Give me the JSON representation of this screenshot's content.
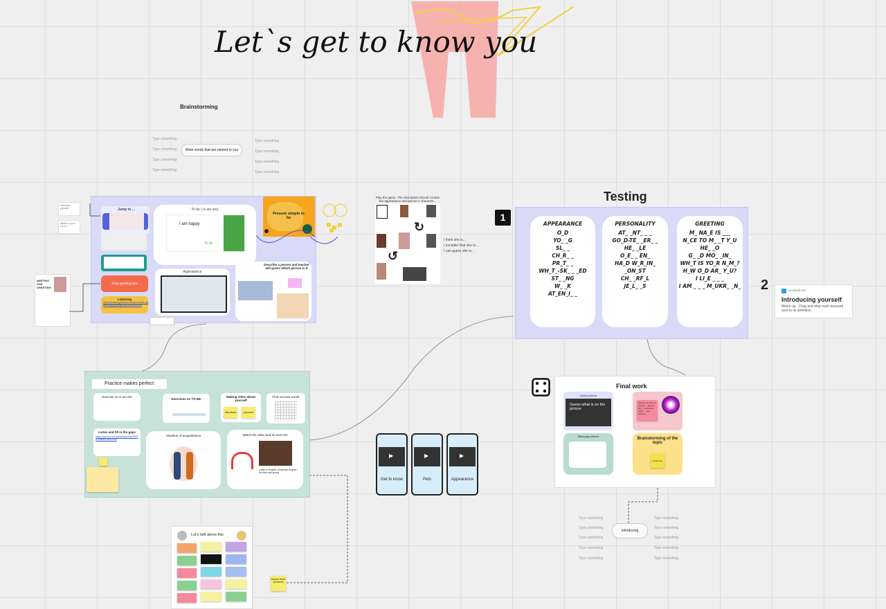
{
  "board": {
    "title": "Let`s get to know you",
    "brainstorm": {
      "label": "Brainstorming",
      "center": "Write words that are related to you",
      "nodes": [
        "Type something",
        "Type something",
        "Type something",
        "Type something",
        "Type something",
        "Type something",
        "Type something",
        "Type something"
      ]
    },
    "left_frame": {
      "jump_label": "Jump to ...",
      "to_be_title": "To be ( is am are)",
      "i_am_happy": "I am happy",
      "to_be_small": "To be",
      "present_simple": "Present simple to be",
      "appearance": "Appearance",
      "describe_person": "Describe a person and teacher will guess which person is it",
      "listening_label": "Listening",
      "orange_label": "Song greeting time",
      "link_text": "https://learnenglishteens.britishcouncil.org/skills/listening/a1-listening/greetings-and-introductions",
      "greeting_card": "MEETING AND GREETING",
      "side_note_1": "Introduce yourself",
      "side_note_2": "Where is your name?",
      "sentence_1": "I think she is...",
      "sentence_2": "I consider that she is...",
      "sentence_3": "I can guess she is...",
      "game_desc": "Play the game. The description should contain the appearance and person`s character..."
    },
    "testing": {
      "title": "Testing",
      "step_number": "1",
      "columns": [
        {
          "header": "APPEARANCE",
          "items": [
            "O_D",
            "YO_ _G",
            "SL_ _",
            "CH_R_ _",
            "PR_T_ _",
            "WH_T_-SK_ _ _ED",
            "ST_ _NG",
            "W_ _K",
            "AT_EN_I_ _"
          ]
        },
        {
          "header": "PERSONALITY",
          "items": [
            "AT_ _NT_ _ _",
            "GO_D-TE_ _ER_ _",
            "HE_ _LE",
            "O_E_ _ EN_",
            "HA_D W_R_IN_",
            "_ON_ST",
            "CH_ _RF_L",
            "JE_L_ _S"
          ]
        },
        {
          "header": "GREETING",
          "items": [
            "M_ NA_E IS ___",
            "N_CE TO M_ _T Y_U",
            "HE_ _O",
            "G_ _D MO_ _IN_",
            "WH_T IS YO_R N_M_?",
            "H_W O_D AR_ Y_U?",
            "I LI_E _ _ _",
            "I AM _ _ _ M_UKR_ _N_"
          ]
        }
      ]
    },
    "introducing": {
      "number": "2",
      "source": "wordwall.net",
      "title": "Introducing yourself",
      "desc": "Match up - Drag and drop each keyword next to its definition."
    },
    "practice": {
      "title": "Practice makes perfect",
      "ex1": "Exercise on is am are",
      "ex2": "Exercises on TO BE",
      "ex3": "Making video about yourself",
      "ex4": "Find out new words",
      "ex5": "Listen and fill in the gaps",
      "ex6": "Situation of acquaintance",
      "ex7": "Watch the video and do exercise",
      "link": "https://quizizz.com/admin/quiz/5ea7b0da79cbcf001bfd1e6b",
      "sticky1": "Introduce",
      "sticky2": "yourself",
      "video_caption": "Listen in English: American English for Kids and young"
    },
    "phones": [
      "Get to know",
      "Pets",
      "Appearance"
    ],
    "final": {
      "title": "Final work",
      "guess_head": "Guess picture",
      "guess_text": "Guess what is on the picture",
      "sticky_text": "Post for you how to explain ... about a pro ... presented some ... own opinion...",
      "blank_head": "Blank page pictures",
      "brainstorm_topic": "Brainstorming of the topic",
      "yellow_sticky": "introducing",
      "dice_icon": "dice-icon"
    },
    "intro_map": {
      "center": "introducing",
      "nodes": [
        "Type something",
        "Type something",
        "Type something",
        "Type something",
        "Type something",
        "Type something",
        "Type something",
        "Type something",
        "Type something",
        "Type something"
      ]
    },
    "bottom_card": {
      "title": "Let's talk about this",
      "sticky": "answer these questions"
    }
  }
}
